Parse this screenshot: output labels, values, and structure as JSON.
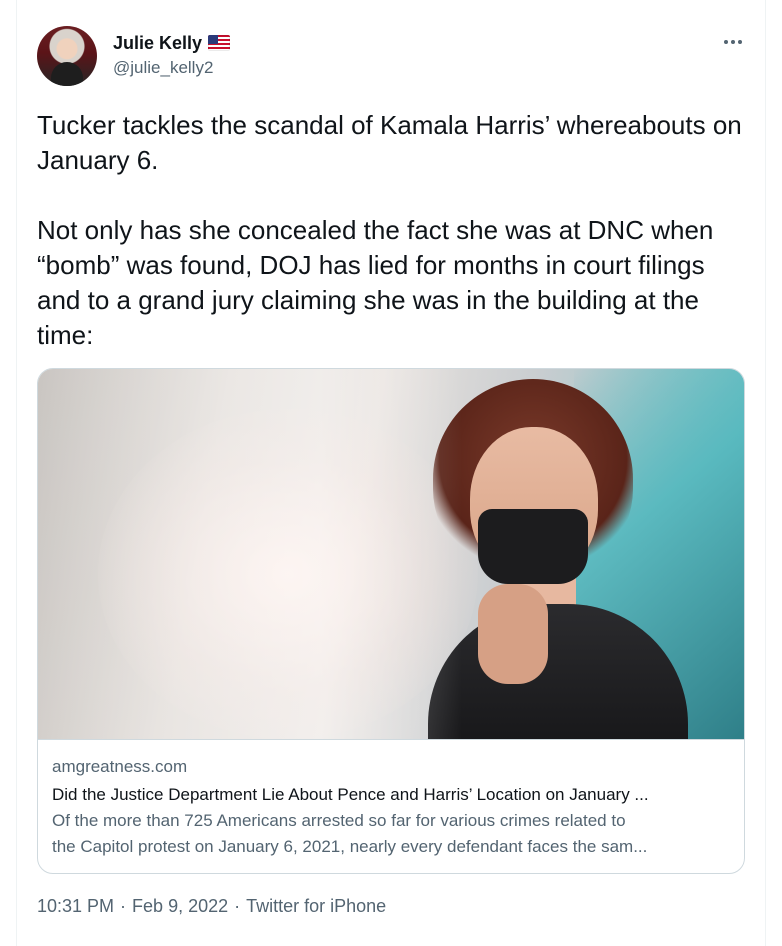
{
  "author": {
    "name": "Julie Kelly",
    "handle": "@julie_kelly2",
    "badge_icon": "us-flag-icon"
  },
  "tweet": {
    "paragraphs": [
      "Tucker tackles the scandal of Kamala Harris’ whereabouts on January 6.",
      "Not only has she concealed the fact she was at DNC when “bomb” was found, DOJ has lied for months in court filings and to a grand jury claiming she was in the building at the time:"
    ]
  },
  "link_card": {
    "domain": "amgreatness.com",
    "title": "Did the Justice Department Lie About Pence and Harris’ Location on January ...",
    "description_lines": [
      "Of the more than 725 Americans arrested so far for various crimes related to",
      "the Capitol protest on January 6, 2021, nearly every defendant faces the sam..."
    ]
  },
  "meta": {
    "time": "10:31 PM",
    "separator": "·",
    "date": "Feb 9, 2022",
    "source": "Twitter for iPhone"
  },
  "colors": {
    "text_primary": "#0f1419",
    "text_secondary": "#536471",
    "border": "#cfd9de"
  }
}
